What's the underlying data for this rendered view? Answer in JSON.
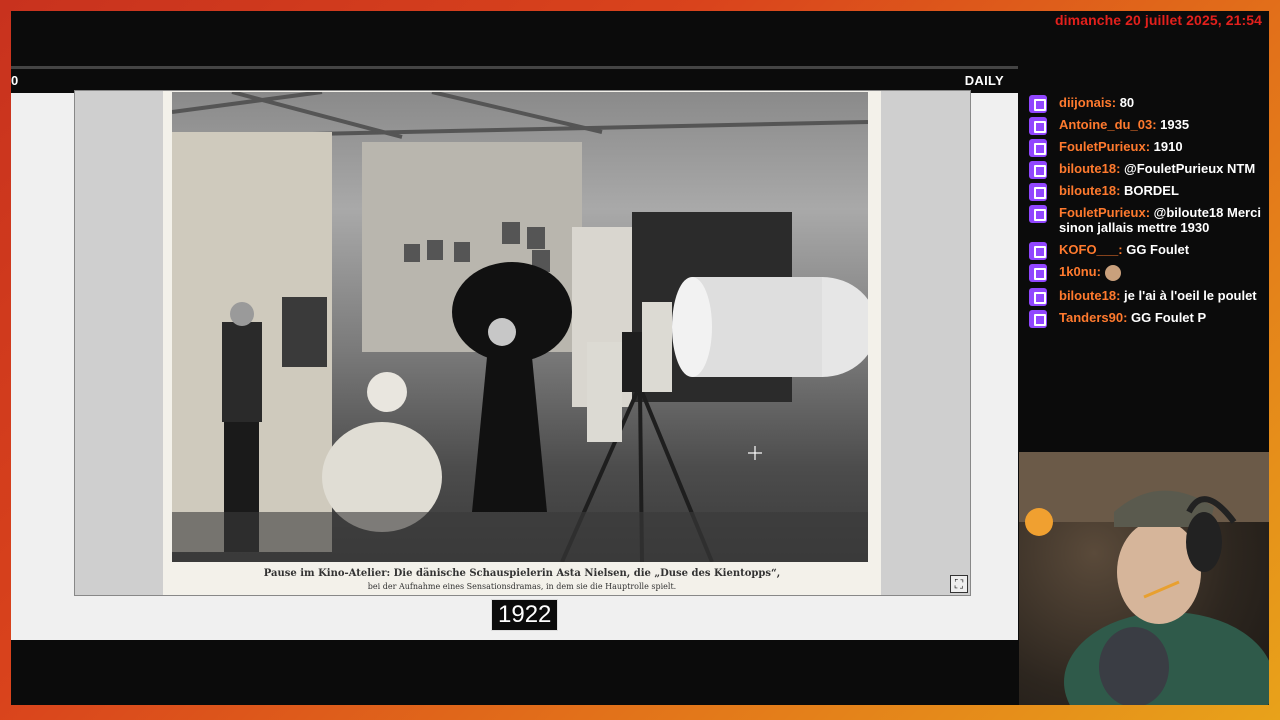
{
  "clock": "dimanche 20 juillet 2025, 21:54",
  "game": {
    "left_number": "0",
    "mode": "DAILY",
    "caption_line1": "Pause im Kino-Atelier: Die dänische Schauspielerin Asta Nielsen, die „Duse des Kientopps“,",
    "caption_line2": "bei der Aufnahme eines Sensationsdramas, in dem sie die Hauptrolle spielt.",
    "fullscreen_icon": "⛶",
    "year": "1922"
  },
  "chat": [
    {
      "user": "diijonais",
      "text": "80"
    },
    {
      "user": "Antoine_du_03",
      "text": "1935"
    },
    {
      "user": "FouletPurieux",
      "text": "1910"
    },
    {
      "user": "biloute18",
      "text": "@FouletPurieux NTM"
    },
    {
      "user": "biloute18",
      "text": "BORDEL"
    },
    {
      "user": "FouletPurieux",
      "text": "@biloute18 Merci sinon jallais mettre 1930"
    },
    {
      "user": "KOFO___",
      "text": "GG Foulet"
    },
    {
      "user": "1k0nu",
      "text": ""
    },
    {
      "user": "biloute18",
      "text": "je l'ai à l'oeil le poulet"
    },
    {
      "user": "Tanders90",
      "text": "GG Foulet P"
    }
  ],
  "colors": {
    "clock": "#e3201c",
    "username": "#ff7a2e",
    "badge": "#9146ff"
  }
}
